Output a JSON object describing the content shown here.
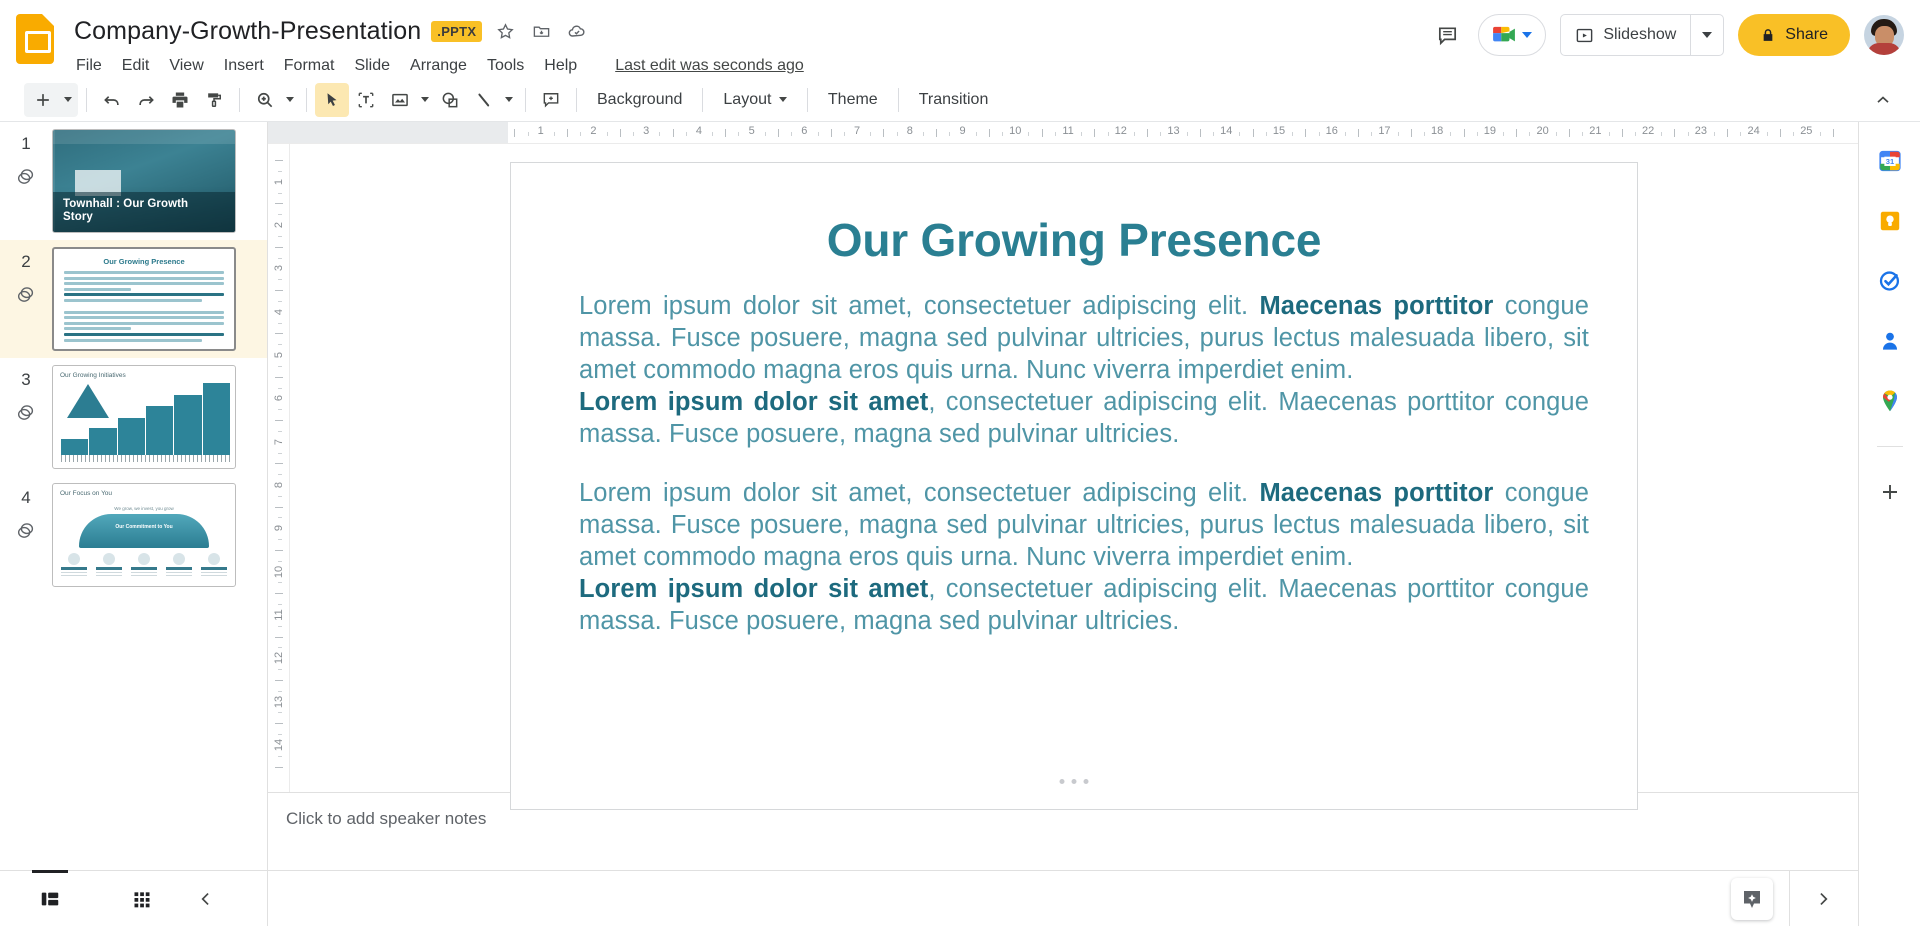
{
  "app": {
    "product": "Google Slides",
    "logo_icon": "slides-logo-icon"
  },
  "header": {
    "doc_title": "Company-Growth-Presentation",
    "file_ext_badge": ".PPTX",
    "star_icon": "star-icon",
    "move_icon": "move-to-folder-icon",
    "cloud_icon": "cloud-saved-icon",
    "menus": [
      "File",
      "Edit",
      "View",
      "Insert",
      "Format",
      "Slide",
      "Arrange",
      "Tools",
      "Help"
    ],
    "last_edit": "Last edit was seconds ago",
    "comment_icon": "comment-history-icon",
    "meet_icon": "google-meet-icon",
    "meet_caret_icon": "chevron-down-icon",
    "slideshow_label": "Slideshow",
    "slideshow_icon": "present-play-icon",
    "slideshow_caret_icon": "chevron-down-icon",
    "share_label": "Share",
    "share_lock_icon": "lock-icon",
    "avatar": "user-avatar",
    "accent_yellow": "#F9C026",
    "accent_blue": "#1a73e8"
  },
  "toolbar": {
    "new_slide_icon": "add-slide-icon",
    "new_slide_caret_icon": "chevron-down-icon",
    "undo_icon": "undo-icon",
    "redo_icon": "redo-icon",
    "print_icon": "print-icon",
    "paint_format_icon": "paint-format-icon",
    "zoom_icon": "zoom-icon",
    "zoom_caret_icon": "chevron-down-icon",
    "select_icon": "select-cursor-icon",
    "textbox_icon": "text-box-icon",
    "image_icon": "insert-image-icon",
    "image_caret_icon": "chevron-down-icon",
    "shape_icon": "insert-shape-icon",
    "line_icon": "insert-line-icon",
    "line_caret_icon": "chevron-down-icon",
    "comment_icon": "add-comment-icon",
    "background_label": "Background",
    "layout_label": "Layout",
    "layout_caret_icon": "chevron-down-icon",
    "theme_label": "Theme",
    "transition_label": "Transition",
    "collapse_icon": "chevron-up-icon"
  },
  "ruler": {
    "unit": "inches",
    "h_ticks": [
      1,
      2,
      3,
      4,
      5,
      6,
      7,
      8,
      9,
      10,
      11,
      12,
      13,
      14,
      15,
      16,
      17,
      18,
      19,
      20,
      21,
      22,
      23,
      24,
      25
    ],
    "v_ticks": [
      1,
      2,
      3,
      4,
      5,
      6,
      7,
      8,
      9,
      10,
      11,
      12,
      13,
      14
    ]
  },
  "filmstrip": {
    "slides": [
      {
        "number": "1",
        "layers_icon": "layers-icon",
        "title": "Townhall : Our Growth Story",
        "selected": false,
        "kind": "title-photo"
      },
      {
        "number": "2",
        "layers_icon": "layers-icon",
        "title": "Our Growing Presence",
        "selected": true,
        "kind": "text"
      },
      {
        "number": "3",
        "layers_icon": "layers-icon",
        "title": "Our Growing Initiatives",
        "selected": false,
        "kind": "stairs-chart"
      },
      {
        "number": "4",
        "layers_icon": "layers-icon",
        "title": "Our Focus on You",
        "caption": "We grow, we invest, you grow",
        "umbrella_label": "Our Commitment to You",
        "selected": false,
        "kind": "umbrella"
      }
    ]
  },
  "slide": {
    "title": "Our Growing Presence",
    "title_color": "#2a7f92",
    "body_color": "#4f95a6",
    "bold_color": "#1d6a7e",
    "paragraphs": [
      {
        "runs": [
          {
            "text": "Lorem ipsum dolor sit amet, consectetuer adipiscing elit. ",
            "bold": false
          },
          {
            "text": "Maecenas porttitor",
            "bold": true
          },
          {
            "text": " congue massa. Fusce posuere, magna sed pulvinar ultricies, purus lectus malesuada libero, sit amet commodo magna eros quis urna. Nunc viverra imperdiet enim.",
            "bold": false
          },
          {
            "text": "\nLorem ipsum dolor sit amet",
            "bold": true
          },
          {
            "text": ", consectetuer adipiscing elit. Maecenas porttitor congue massa. Fusce posuere, magna sed pulvinar ultricies.",
            "bold": false
          }
        ]
      },
      {
        "runs": [
          {
            "text": "Lorem ipsum dolor sit amet, consectetuer adipiscing elit. ",
            "bold": false
          },
          {
            "text": "Maecenas porttitor",
            "bold": true
          },
          {
            "text": " congue massa. Fusce posuere, magna sed pulvinar ultricies, purus lectus malesuada libero, sit amet commodo magna eros quis urna. Nunc viverra imperdiet enim.",
            "bold": false
          },
          {
            "text": "\nLorem ipsum dolor sit amet",
            "bold": true
          },
          {
            "text": ", consectetuer adipiscing elit. Maecenas porttitor congue massa. Fusce posuere, magna sed pulvinar ultricies.",
            "bold": false
          }
        ]
      }
    ]
  },
  "notes": {
    "placeholder": "Click to add speaker notes"
  },
  "bottombar": {
    "filmstrip_view_icon": "filmstrip-view-icon",
    "grid_view_icon": "grid-view-icon",
    "collapse_filmstrip_icon": "chevron-left-icon",
    "explore_icon": "explore-sparkle-icon",
    "expand_rail_icon": "chevron-right-icon"
  },
  "rail": {
    "items": [
      {
        "name": "google-calendar-icon",
        "label": "Calendar",
        "badge": "31"
      },
      {
        "name": "google-keep-icon",
        "label": "Keep"
      },
      {
        "name": "google-tasks-icon",
        "label": "Tasks"
      },
      {
        "name": "google-contacts-icon",
        "label": "Contacts"
      },
      {
        "name": "google-maps-icon",
        "label": "Maps"
      }
    ],
    "add_icon": "add-addon-icon"
  }
}
